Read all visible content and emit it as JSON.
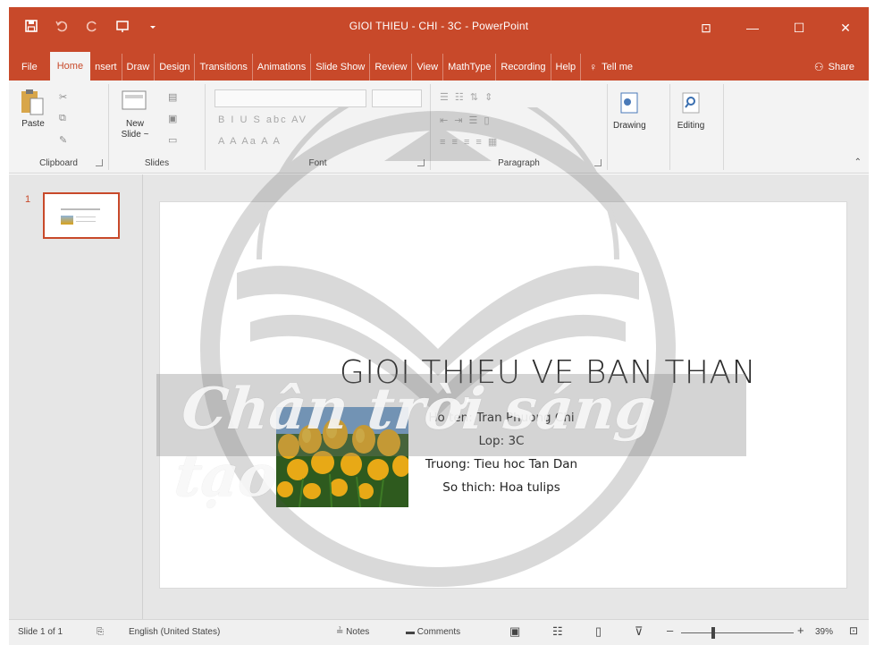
{
  "window": {
    "title": "GIOI THIEU - CHI - 3C  -  PowerPoint",
    "controls": [
      "⊡",
      "—",
      "☐",
      "✕"
    ]
  },
  "quick_access": [
    {
      "name": "save-icon"
    },
    {
      "name": "undo-icon"
    },
    {
      "name": "redo-icon"
    },
    {
      "name": "start-slideshow-icon"
    },
    {
      "name": "customize-qat-icon"
    }
  ],
  "tabs": {
    "file": "File",
    "home": "Home",
    "insert": "nsert",
    "draw": "Draw",
    "design": "Design",
    "transitions": "Transitions",
    "animations": "Animations",
    "slideshow": "Slide Show",
    "review": "Review",
    "view": "View",
    "mathtype": "MathType",
    "recording": "Recording",
    "help": "Help",
    "tellme": "Tell me",
    "share": "Share"
  },
  "ribbon": {
    "clipboard": {
      "label": "Clipboard",
      "paste": "Paste"
    },
    "slides": {
      "label": "Slides",
      "new_slide_1": "New",
      "new_slide_2": "Slide ~"
    },
    "font": {
      "label": "Font"
    },
    "paragraph": {
      "label": "Paragraph"
    },
    "drawing": {
      "label": "Drawing"
    },
    "editing": {
      "label": "Editing"
    }
  },
  "thumbnails": [
    {
      "number": "1"
    }
  ],
  "slide": {
    "title": "GIOI THIEU VE BAN THAN",
    "lines": [
      "Ho ten: Tran Phuong Chi",
      "Lop: 3C",
      "Truong: Tieu hoc Tan Dan",
      "So thich: Hoa tulips"
    ]
  },
  "watermark": {
    "text": "Chân trời sáng tạo"
  },
  "statusbar": {
    "slide_info": "Slide 1 of 1",
    "language": "English (United States)",
    "notes": "Notes",
    "comments": "Comments",
    "zoom": "39%"
  },
  "colors": {
    "accent": "#c8492a",
    "ribbon": "#f3f3f3",
    "workspace": "#e6e6e6"
  }
}
